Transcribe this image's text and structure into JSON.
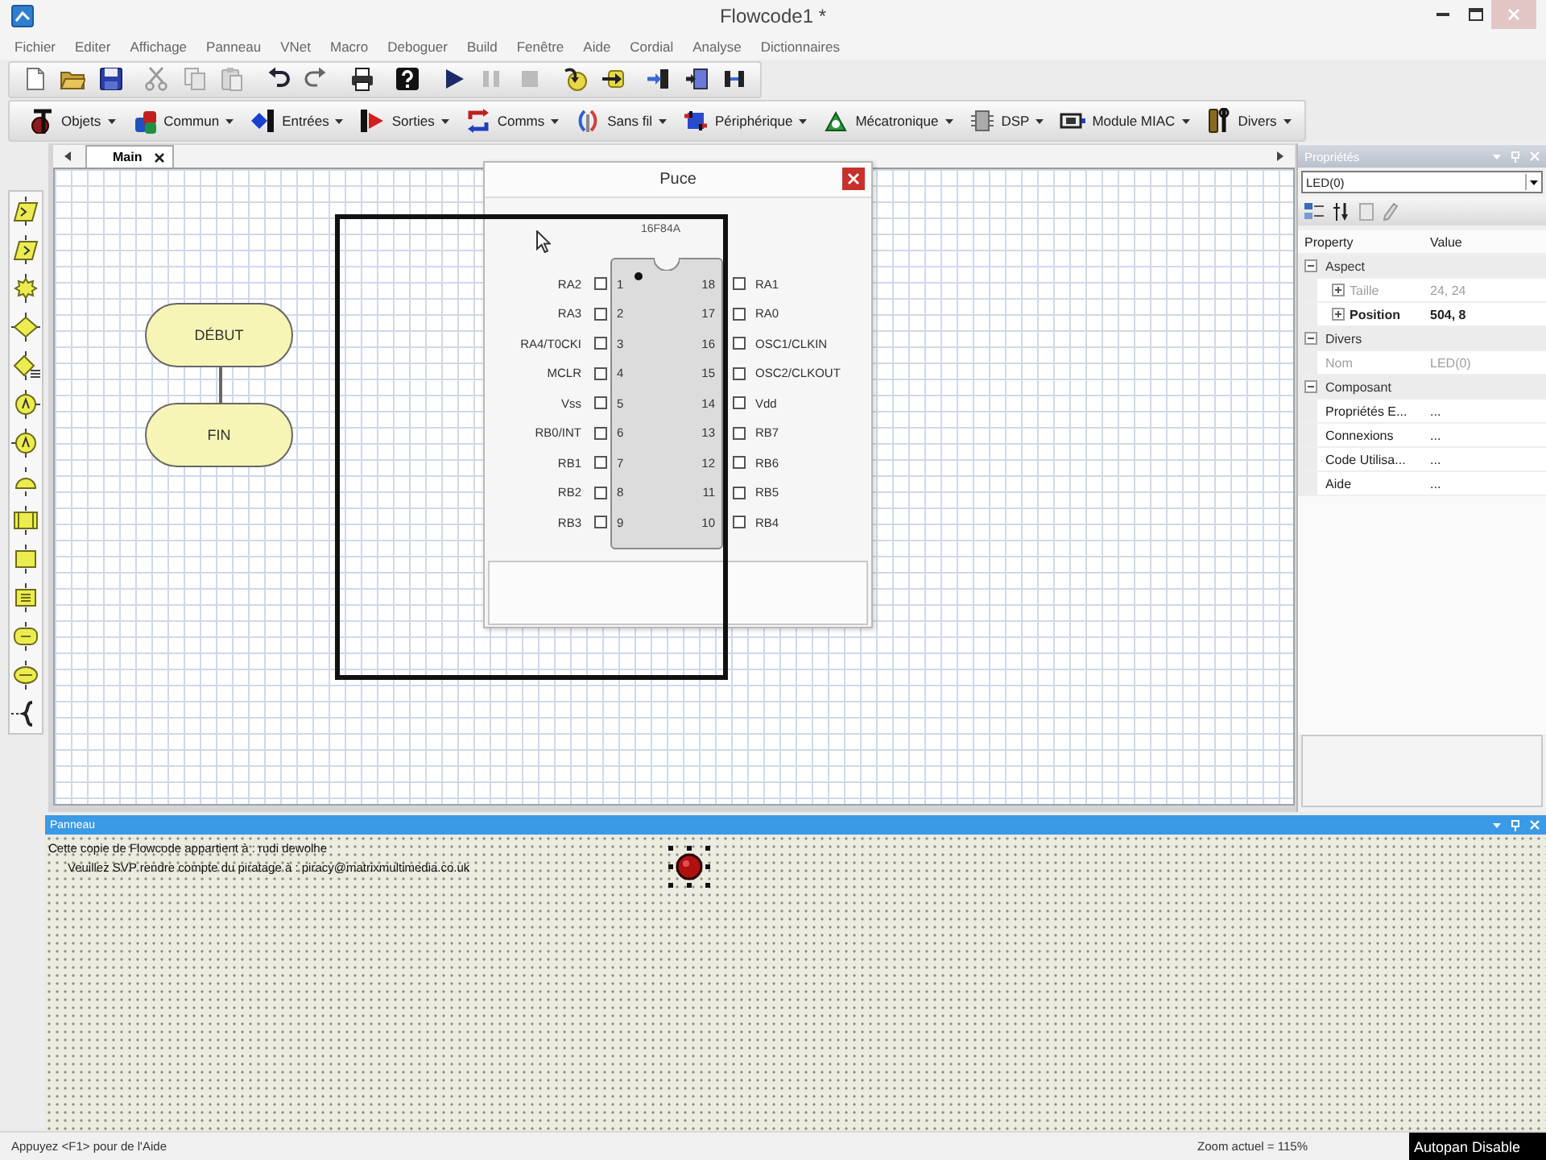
{
  "window": {
    "title": "Flowcode1 *"
  },
  "menu": [
    "Fichier",
    "Editer",
    "Affichage",
    "Panneau",
    "VNet",
    "Macro",
    "Deboguer",
    "Build",
    "Fenêtre",
    "Aide",
    "Cordial",
    "Analyse",
    "Dictionnaires"
  ],
  "component_menus": [
    "Objets",
    "Commun",
    "Entrées",
    "Sorties",
    "Comms",
    "Sans fil",
    "Périphérique",
    "Mécatronique",
    "DSP",
    "Module MIAC",
    "Divers"
  ],
  "document_tabs": [
    {
      "label": "Main",
      "selected": true
    }
  ],
  "flowchart": {
    "nodes": [
      "DÉBUT",
      "FIN"
    ]
  },
  "chip_window": {
    "title": "Puce",
    "chip": "16F84A",
    "left_pins": [
      {
        "number": "1",
        "name": "RA2",
        "on": false
      },
      {
        "number": "2",
        "name": "RA3",
        "on": false
      },
      {
        "number": "3",
        "name": "RA4/T0CKI",
        "on": false
      },
      {
        "number": "4",
        "name": "MCLR",
        "on": false
      },
      {
        "number": "5",
        "name": "Vss",
        "on": false
      },
      {
        "number": "6",
        "name": "RB0/INT",
        "on": false
      },
      {
        "number": "7",
        "name": "RB1",
        "on": false
      },
      {
        "number": "8",
        "name": "RB2",
        "on": false
      },
      {
        "number": "9",
        "name": "RB3",
        "on": false
      }
    ],
    "right_pins": [
      {
        "number": "18",
        "name": "RA1",
        "on": false
      },
      {
        "number": "17",
        "name": "RA0",
        "on": false
      },
      {
        "number": "16",
        "name": "OSC1/CLKIN",
        "on": false
      },
      {
        "number": "15",
        "name": "OSC2/CLKOUT",
        "on": false
      },
      {
        "number": "14",
        "name": "Vdd",
        "on": false
      },
      {
        "number": "13",
        "name": "RB7",
        "on": false
      },
      {
        "number": "12",
        "name": "RB6",
        "on": false
      },
      {
        "number": "11",
        "name": "RB5",
        "on": false
      },
      {
        "number": "10",
        "name": "RB4",
        "on": false
      }
    ]
  },
  "properties": {
    "title": "Propriétés",
    "selector": "LED(0)",
    "columns": [
      "Property",
      "Value"
    ],
    "groups": [
      {
        "name": "Aspect",
        "expanded": true,
        "rows": [
          {
            "name": "Taille",
            "value": "24, 24",
            "expanded": false,
            "disabled": true,
            "modified": false
          },
          {
            "name": "Position",
            "value": "504, 8",
            "expanded": false,
            "disabled": false,
            "modified": true
          }
        ]
      },
      {
        "name": "Divers",
        "expanded": true,
        "rows": [
          {
            "name": "Nom",
            "value": "LED(0)",
            "disabled": true,
            "modified": false
          }
        ]
      },
      {
        "name": "Composant",
        "expanded": true,
        "rows": [
          {
            "name": "Propriétés E...",
            "value": "...",
            "disabled": false,
            "modified": false
          },
          {
            "name": "Connexions",
            "value": "...",
            "disabled": false,
            "modified": false
          },
          {
            "name": "Code Utilisa...",
            "value": "...",
            "disabled": false,
            "modified": false
          },
          {
            "name": "Aide",
            "value": "...",
            "disabled": false,
            "modified": false
          }
        ]
      }
    ]
  },
  "panel": {
    "title": "Panneau",
    "notice": [
      "Cette copie de Flowcode appartient à : rudi dewolhe",
      "Veuillez SVP rendre compte du piratage à : piracy@matrixmultimedia.co.uk"
    ],
    "led": {
      "selected": true
    }
  },
  "status_bar": {
    "hint": "Appuyez <F1> pour de l'Aide",
    "zoom": "Zoom actuel = 115%",
    "autopan": "Autopan Disable"
  }
}
